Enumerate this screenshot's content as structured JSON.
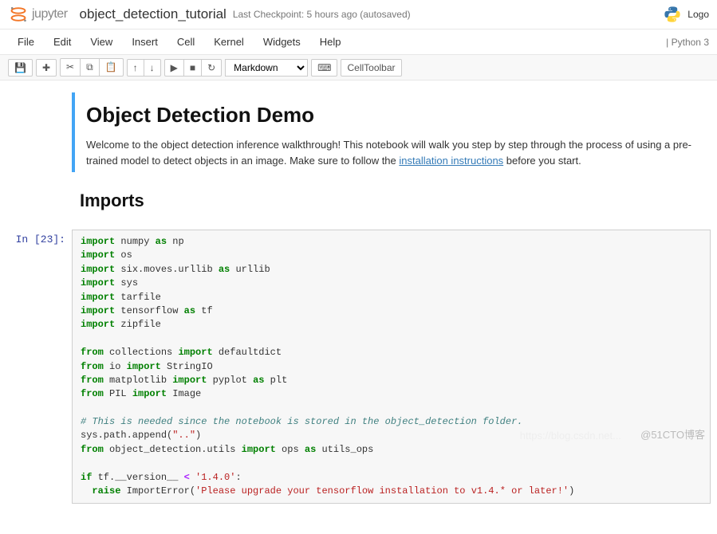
{
  "header": {
    "logo_text": "jupyter",
    "notebook_name": "object_detection_tutorial",
    "checkpoint": "Last Checkpoint: 5 hours ago (autosaved)",
    "logout": "Logo"
  },
  "menubar": {
    "items": [
      "File",
      "Edit",
      "View",
      "Insert",
      "Cell",
      "Kernel",
      "Widgets",
      "Help"
    ],
    "kernel": "Python 3"
  },
  "toolbar": {
    "save_icon": "💾",
    "add_icon": "✚",
    "cut_icon": "✂",
    "copy_icon": "⧉",
    "paste_icon": "📋",
    "up_icon": "↑",
    "down_icon": "↓",
    "run_icon": "▶",
    "stop_icon": "■",
    "restart_icon": "↻",
    "cell_type": "Markdown",
    "command_icon": "⌨",
    "celltoolbar": "CellToolbar"
  },
  "cells": {
    "md1_title": "Object Detection Demo",
    "md1_p1a": "Welcome to the object detection inference walkthrough! This notebook will walk you step by step through the process of using a pre-trained model to detect objects in an image. Make sure to follow the ",
    "md1_link": "installation instructions",
    "md1_p1b": " before you start.",
    "md2_title": "Imports",
    "code1_prompt": "In  [23]:"
  },
  "code": {
    "l1_kw": "import",
    "l1_mod": " numpy ",
    "l1_as": "as",
    "l1_al": " np",
    "l2_kw": "import",
    "l2_mod": " os",
    "l3_kw": "import",
    "l3_mod": " six.moves.urllib ",
    "l3_as": "as",
    "l3_al": " urllib",
    "l4_kw": "import",
    "l4_mod": " sys",
    "l5_kw": "import",
    "l5_mod": " tarfile",
    "l6_kw": "import",
    "l6_mod": " tensorflow ",
    "l6_as": "as",
    "l6_al": " tf",
    "l7_kw": "import",
    "l7_mod": " zipfile",
    "l8_kw": "from",
    "l8_mod": " collections ",
    "l8_im": "import",
    "l8_nm": " defaultdict",
    "l9_kw": "from",
    "l9_mod": " io ",
    "l9_im": "import",
    "l9_nm": " StringIO",
    "l10_kw": "from",
    "l10_mod": " matplotlib ",
    "l10_im": "import",
    "l10_nm": " pyplot ",
    "l10_as": "as",
    "l10_al": " plt",
    "l11_kw": "from",
    "l11_mod": " PIL ",
    "l11_im": "import",
    "l11_nm": " Image",
    "l12_cmt": "# This is needed since the notebook is stored in the object_detection folder.",
    "l13_a": "sys.path.append(",
    "l13_s": "\"..\"",
    "l13_b": ")",
    "l14_kw": "from",
    "l14_mod": " object_detection.utils ",
    "l14_im": "import",
    "l14_nm": " ops ",
    "l14_as": "as",
    "l14_al": " utils_ops",
    "l15_kw": "if",
    "l15_a": " tf.__version__ ",
    "l15_op": "<",
    "l15_b": " ",
    "l15_s": "'1.4.0'",
    "l15_c": ":",
    "l16_sp": "  ",
    "l16_kw": "raise",
    "l16_a": " ImportError(",
    "l16_s": "'Please upgrade your tensorflow installation to v1.4.* or later!'",
    "l16_b": ")"
  },
  "watermark": "@51CTO博客",
  "faint_url": "https://blog.csdn.net..."
}
